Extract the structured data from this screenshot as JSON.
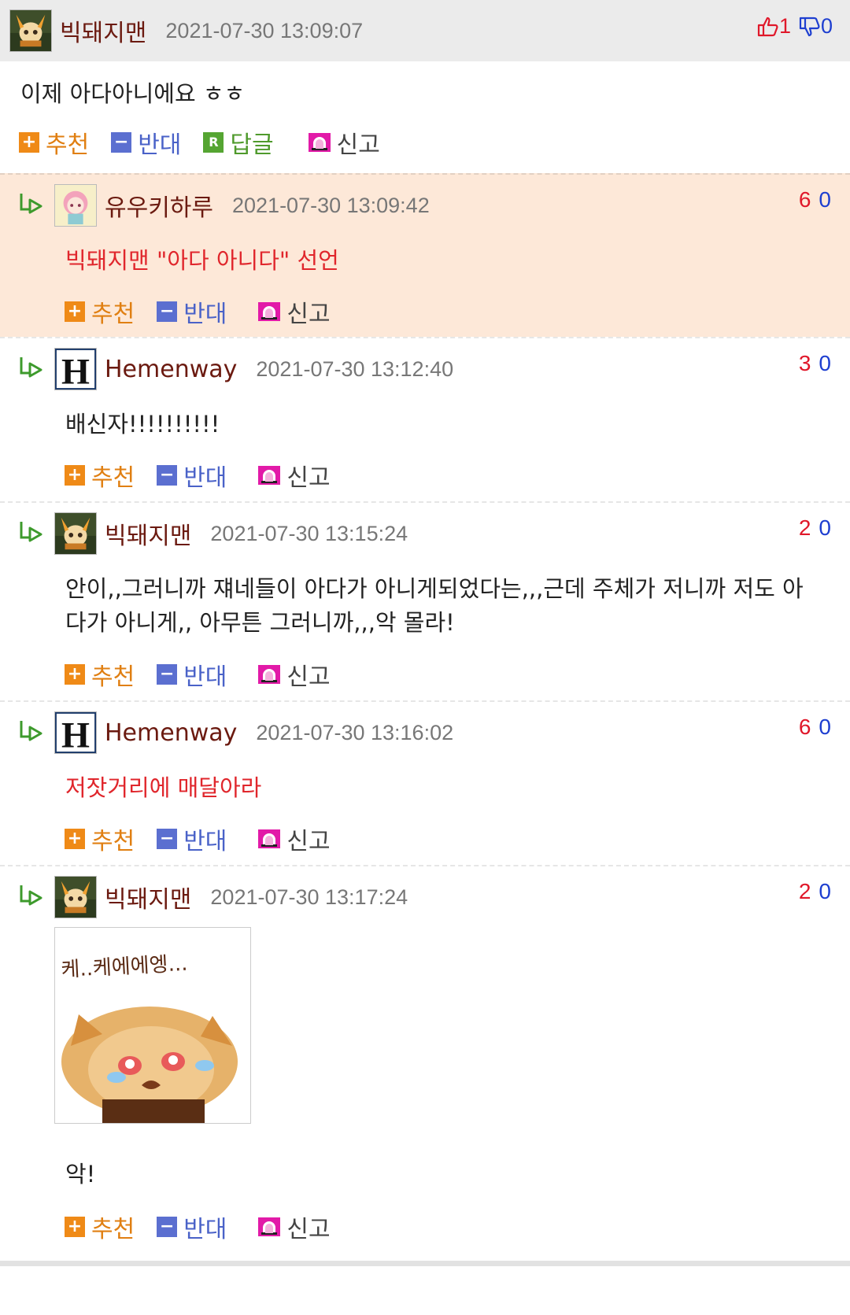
{
  "main_comment": {
    "nickname": "빅돼지맨",
    "date": "2021-07-30 13:09:07",
    "upvotes": "1",
    "downvotes": "0",
    "text": "이제 아다아니에요 ㅎㅎ",
    "actions": {
      "recommend": "추천",
      "oppose": "반대",
      "reply": "답글",
      "report": "신고"
    }
  },
  "replies": [
    {
      "nickname": "유우키하루",
      "date": "2021-07-30 13:09:42",
      "up": "6",
      "down": "0",
      "text": "빅돼지맨 \"아다 아니다\" 선언",
      "highlight": true,
      "text_color": "#e0262c"
    },
    {
      "nickname": "Hemenway",
      "date": "2021-07-30 13:12:40",
      "up": "3",
      "down": "0",
      "text": "배신자!!!!!!!!!!"
    },
    {
      "nickname": "빅돼지맨",
      "date": "2021-07-30 13:15:24",
      "up": "2",
      "down": "0",
      "text": "안이,,그러니까 쟤네들이 아다가 아니게되었다는,,,근데 주체가 저니까 저도 아다가 아니게,, 아무튼 그러니까,,,악 몰라!"
    },
    {
      "nickname": "Hemenway",
      "date": "2021-07-30 13:16:02",
      "up": "6",
      "down": "0",
      "text": "저잣거리에 매달아라",
      "text_color": "#e0262c"
    },
    {
      "nickname": "빅돼지맨",
      "date": "2021-07-30 13:17:24",
      "up": "2",
      "down": "0",
      "text": "악!",
      "sticker_caption": "케..케에에엥..."
    }
  ],
  "reply_actions": {
    "recommend": "추천",
    "oppose": "반대",
    "report": "신고"
  },
  "icons": {
    "recommend": "plus-square-icon",
    "oppose": "minus-square-icon",
    "reply": "reply-r-icon",
    "report": "siren-icon",
    "reply_arrow": "reply-arrow-icon",
    "thumbs_up": "thumbs-up-icon",
    "thumbs_down": "thumbs-down-icon"
  },
  "colors": {
    "header_bg": "#ebebeb",
    "highlight_bg": "#fde8d8",
    "nickname": "#6b1a10",
    "up": "#e0182a",
    "down": "#1e3fd0"
  }
}
